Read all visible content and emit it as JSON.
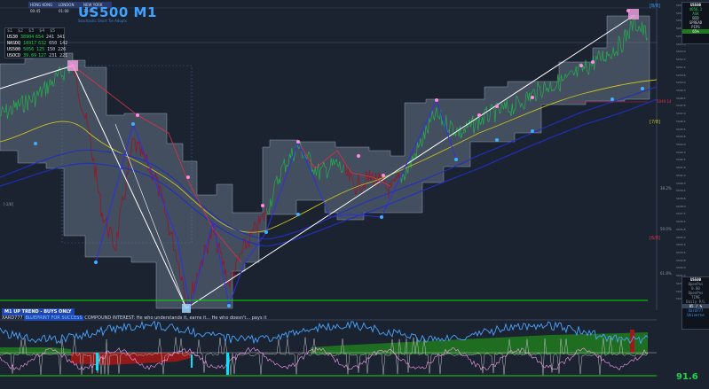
{
  "sessions": [
    "HONG KONG 00:45",
    "LONDON 01:00",
    "NEW YORK 10:00"
  ],
  "title": {
    "symbol_tf": "US500 M1",
    "subtitle": "Stochastic Short Tie Adopts"
  },
  "watchlist": {
    "header": [
      "$1",
      "$2",
      "$3",
      "$4",
      "$5"
    ],
    "rows": [
      {
        "sym": "US30",
        "v1": "38904",
        "v2": "654",
        "v3": "241",
        "v4": "341"
      },
      {
        "sym": "NASDQ",
        "v1": "18917",
        "v2": "632",
        "v3": "650",
        "v4": "142"
      },
      {
        "sym": "US500",
        "v1": "5056",
        "v2": "125",
        "v3": "150",
        "v4": "226"
      },
      {
        "sym": "USOCD",
        "v1": "39.69",
        "v2": "127",
        "v3": "231",
        "v4": "221"
      }
    ]
  },
  "murray_labels": [
    "[8/8]",
    "[7/8]",
    "[6/8]",
    "[-2/8]"
  ],
  "price_axis": [
    "5057.5",
    "5056.8",
    "5056.0",
    "5055.3",
    "5054.5",
    "5053.8",
    "5053.0",
    "5052.3",
    "5051.5",
    "5050.8",
    "5050.0",
    "5049.3",
    "5048.5",
    "5047.8",
    "5047.0",
    "5046.3",
    "5045.5",
    "5044.8",
    "5044.0",
    "5043.3",
    "5042.5",
    "5041.8",
    "5041.0",
    "5040.3",
    "5039.5",
    "5038.8",
    "5038.0",
    "5037.3",
    "5036.5",
    "5035.8",
    "5035.0",
    "5034.3",
    "5033.5",
    "5032.8",
    "5032.0",
    "5031.3",
    "5030.5",
    "5029.8",
    "5029.0"
  ],
  "fib_labels": [
    "38.2%",
    "50.0%",
    "61.8%"
  ],
  "red_level": {
    "label": "5049.14"
  },
  "right_panel_top": {
    "symbol": "US500",
    "price": "5056.1",
    "lines": [
      "BUY",
      "MARGIN",
      "4HOURS",
      "5D TIME",
      "45%"
    ]
  },
  "side_top": {
    "symbol": "US500",
    "price": "4056.1",
    "lines": [
      "ASK",
      "BID",
      "SPREAD",
      "PIPS"
    ],
    "pct": "65%"
  },
  "side_bottom": {
    "symbol": "US500",
    "lines": [
      "OpenPos",
      "0.00",
      "OpenPos",
      "TIME",
      "Daily P/L",
      "05 / %",
      "Xard777",
      "Universe"
    ]
  },
  "trend_banner": "M1 UP TREND - BUYS ONLY",
  "ticker_prefix": "XARD777",
  "ticker_highlight": "BLUEPRINT FOR SUCCESS",
  "ticker_text": "COMPOUND INTEREST: He who understands it, earns it... He who doesn't... pays it",
  "osc_value": "91.6",
  "colors": {
    "background": "#1b2331",
    "band": "#7d8aa0",
    "bull": "#22b14c",
    "bear": "#a01020",
    "zigzag": "#3030e0",
    "trendline": "#ffffff",
    "support_line": "#00e000",
    "banner": "#1e46b4",
    "osc_line": "#4aa3ff",
    "osc_pink": "#ff9ff3",
    "osc_green_fill": "#1f7a1f",
    "osc_red_fill": "#a01818",
    "cyan": "#00e5ff"
  }
}
